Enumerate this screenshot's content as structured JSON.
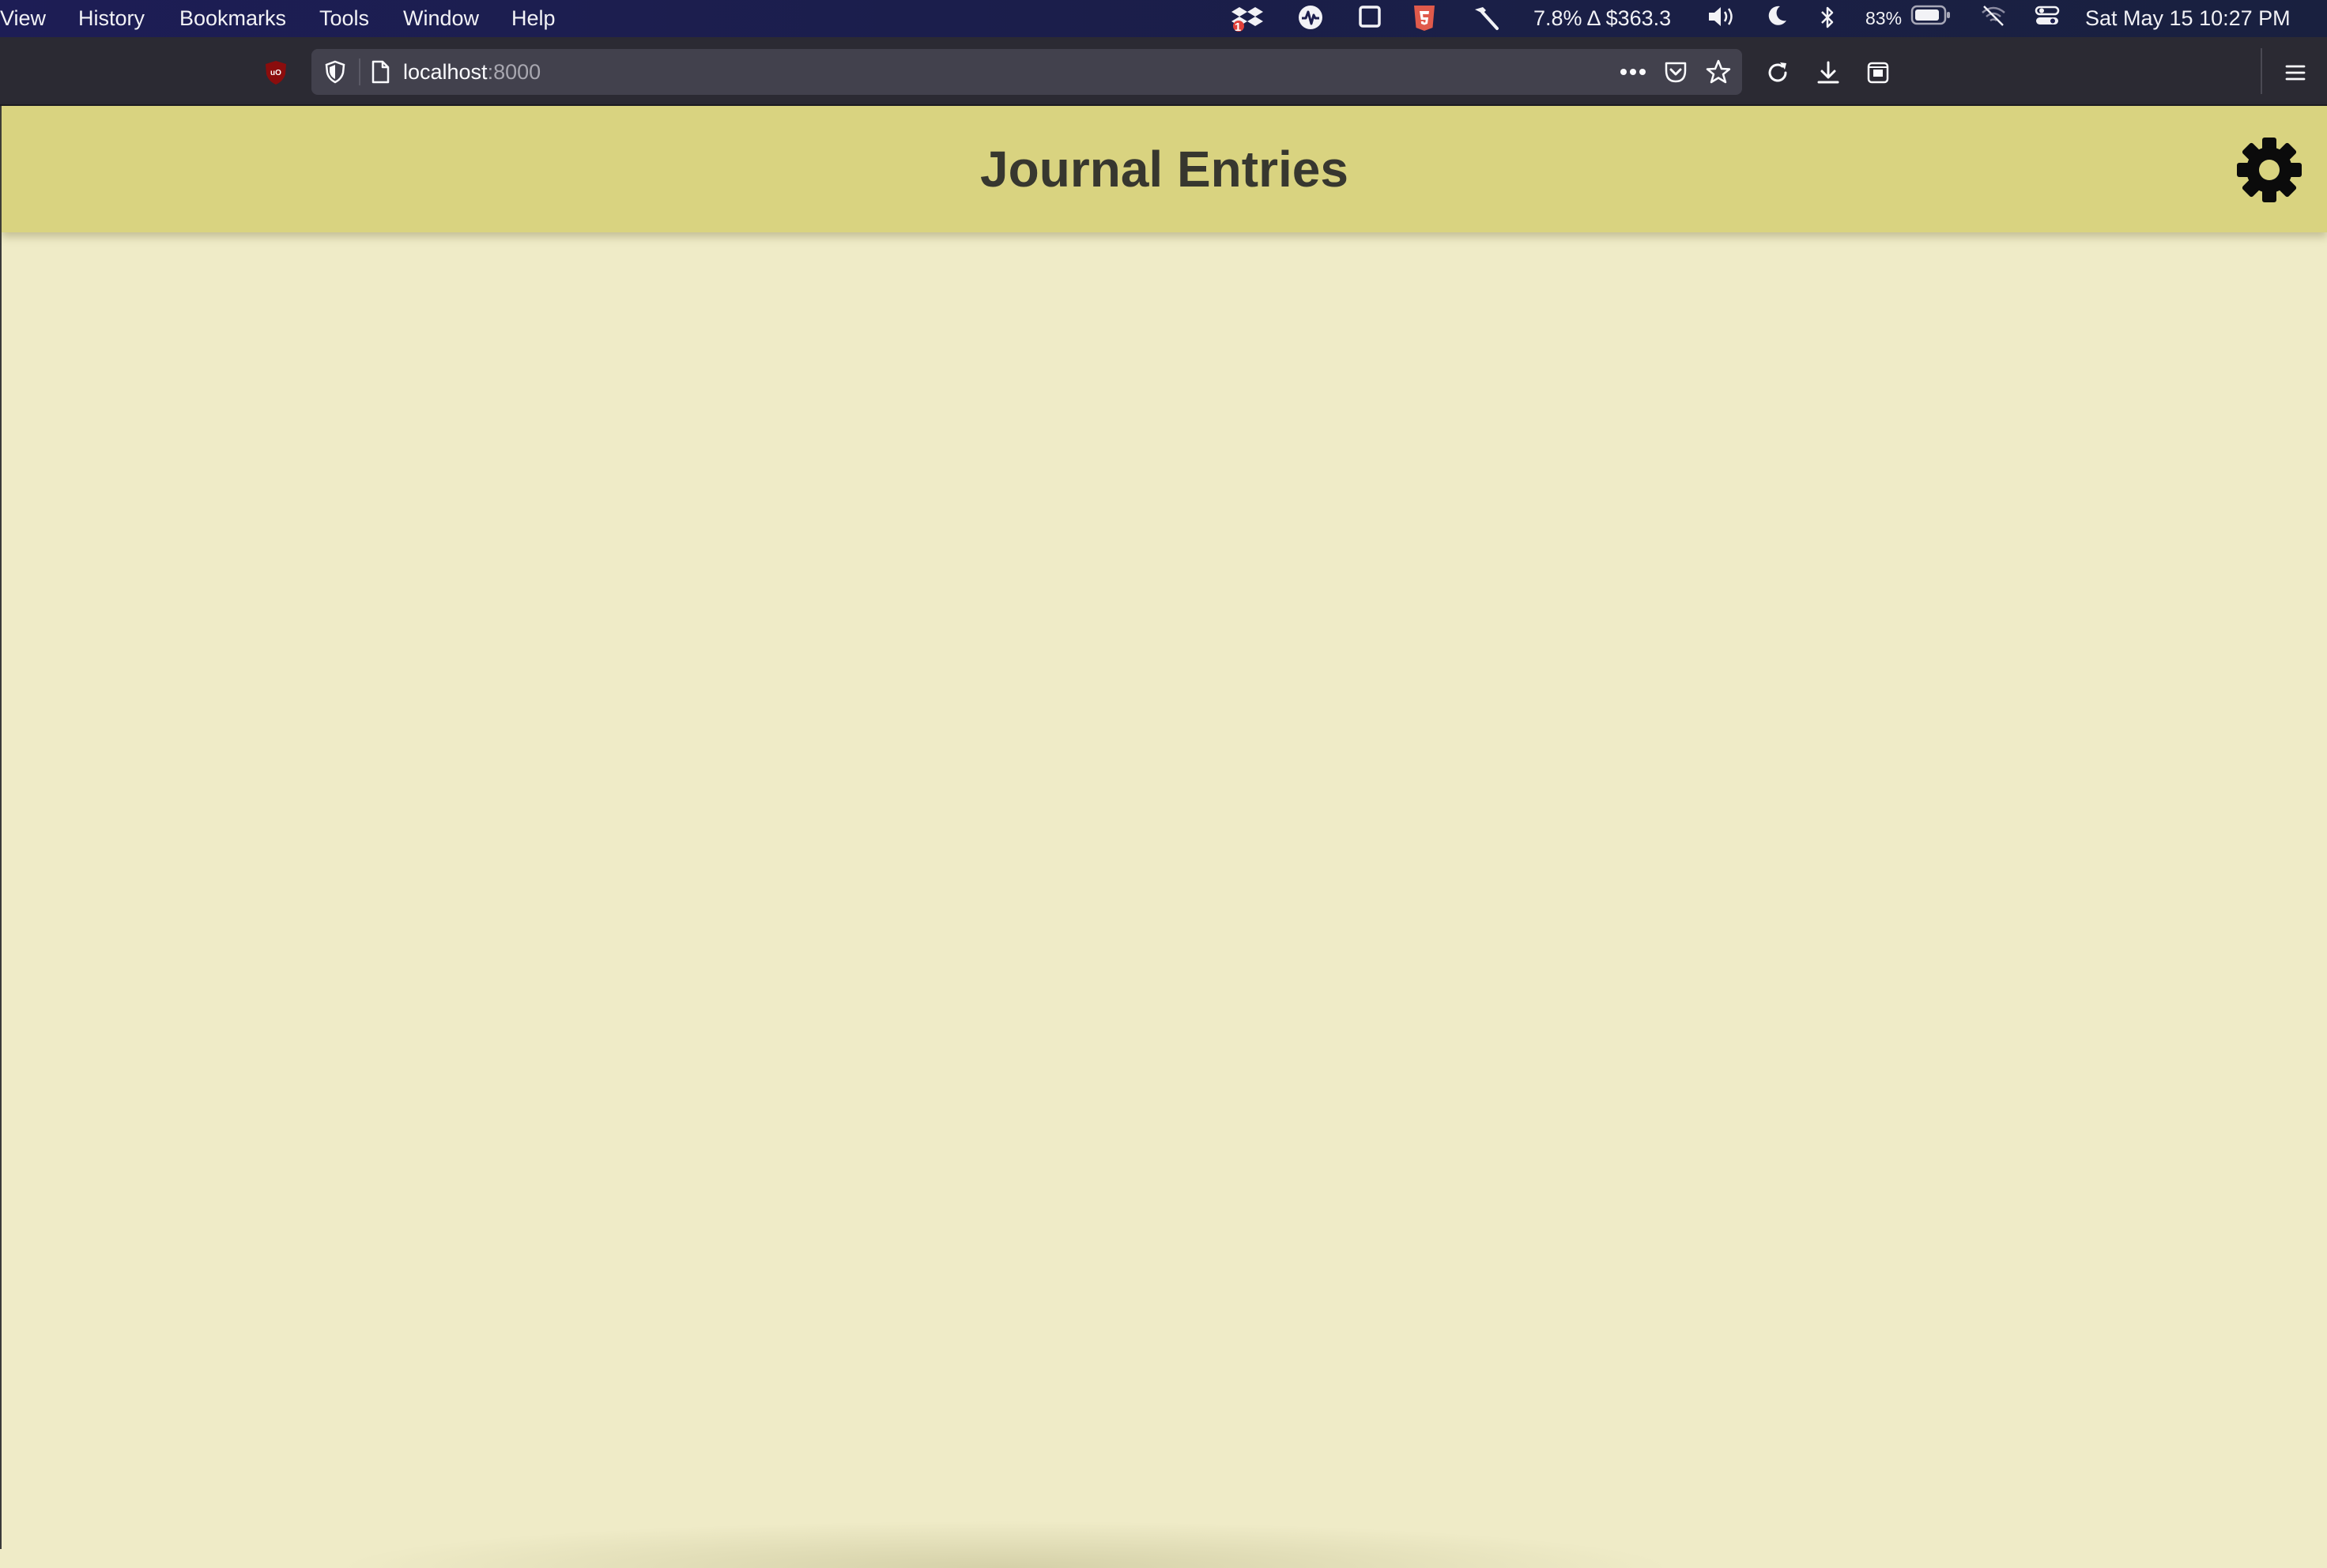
{
  "menubar": {
    "items": [
      {
        "label": "View"
      },
      {
        "label": "History"
      },
      {
        "label": "Bookmarks"
      },
      {
        "label": "Tools"
      },
      {
        "label": "Window"
      },
      {
        "label": "Help"
      }
    ],
    "status": {
      "dropbox_badge": "1",
      "stock_ticker": "7.8% Δ $363.3",
      "battery_percent": "83%",
      "datetime": "Sat May 15  10:27 PM"
    },
    "icons": [
      "dropbox-icon",
      "activity-monitor-icon",
      "window-icon",
      "html5-icon",
      "hammer-icon",
      "volume-icon",
      "moon-icon",
      "bluetooth-icon",
      "battery-icon",
      "wifi-off-icon",
      "control-center-icon"
    ]
  },
  "browser": {
    "url_host": "localhost",
    "url_port": ":8000",
    "toolbar_icons": [
      "ublock-icon",
      "tracking-shield-icon",
      "page-icon",
      "more-dots-icon",
      "pocket-icon",
      "bookmark-star-icon",
      "reload-icon",
      "download-icon",
      "extension-icon",
      "hamburger-menu-icon"
    ]
  },
  "app": {
    "title": "Journal Entries",
    "settings_icon": "gear-icon",
    "colors": {
      "header_bg": "#d9d380",
      "page_bg": "#efebc7",
      "title_text": "#37372f"
    }
  }
}
